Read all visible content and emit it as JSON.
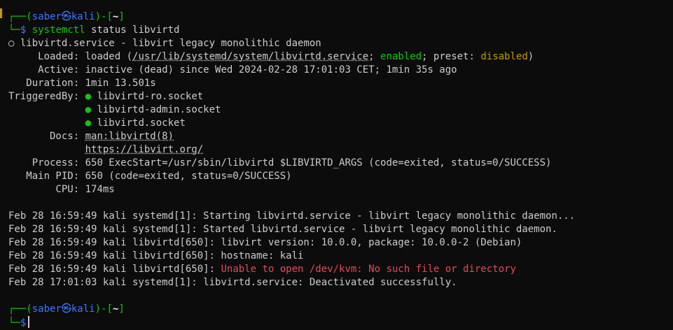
{
  "prompt1": {
    "frame_top": "┌──(",
    "user": "saber",
    "skull": "㉿",
    "host": "kali",
    "close": ")-[",
    "path": "~",
    "end": "]",
    "frame_bottom": "└─",
    "symbol": "$"
  },
  "command": {
    "name": "systemctl",
    "args": " status libvirtd"
  },
  "status": {
    "header_dot": "○",
    "header": " libvirtd.service - libvirt legacy monolithic daemon",
    "loaded_label": "     Loaded:",
    "loaded_pre": " loaded (",
    "loaded_path": "/usr/lib/systemd/system/libvirtd.service",
    "loaded_sep": "; ",
    "loaded_enabled": "enabled",
    "loaded_preset": "; preset: ",
    "loaded_disabled": "disabled",
    "loaded_post": ")",
    "active_label": "     Active:",
    "active_value": " inactive (dead) since Wed 2024-02-28 17:01:03 CET; 1min 35s ago",
    "duration_label": "   Duration:",
    "duration_value": " 1min 13.501s",
    "triggered_label": "TriggeredBy:",
    "triggers": [
      "libvirtd-ro.socket",
      "libvirtd-admin.socket",
      "libvirtd.socket"
    ],
    "trigger_dot": "●",
    "docs_label": "       Docs:",
    "docs": [
      "man:libvirtd(8)",
      "https://libvirt.org/"
    ],
    "process_label": "    Process:",
    "process_value": " 650 ExecStart=/usr/sbin/libvirtd $LIBVIRTD_ARGS (code=exited, status=0/SUCCESS)",
    "mainpid_label": "   Main PID:",
    "mainpid_value": " 650 (code=exited, status=0/SUCCESS)",
    "cpu_label": "        CPU:",
    "cpu_value": " 174ms"
  },
  "logs": {
    "l1": "Feb 28 16:59:49 kali systemd[1]: Starting libvirtd.service - libvirt legacy monolithic daemon...",
    "l2": "Feb 28 16:59:49 kali systemd[1]: Started libvirtd.service - libvirt legacy monolithic daemon.",
    "l3": "Feb 28 16:59:49 kali libvirtd[650]: libvirt version: 10.0.0, package: 10.0.0-2 (Debian)",
    "l4": "Feb 28 16:59:49 kali libvirtd[650]: hostname: kali",
    "l5_pre": "Feb 28 16:59:49 kali libvirtd[650]: ",
    "l5_err": "Unable to open /dev/kvm: No such file or directory",
    "l6": "Feb 28 17:01:03 kali systemd[1]: libvirtd.service: Deactivated successfully."
  },
  "colors": {
    "background": "#0c0c0c",
    "text": "#cccccc",
    "green": "#16c60c",
    "blue": "#3b78ff",
    "yellow": "#c19c00",
    "red": "#e74856"
  }
}
